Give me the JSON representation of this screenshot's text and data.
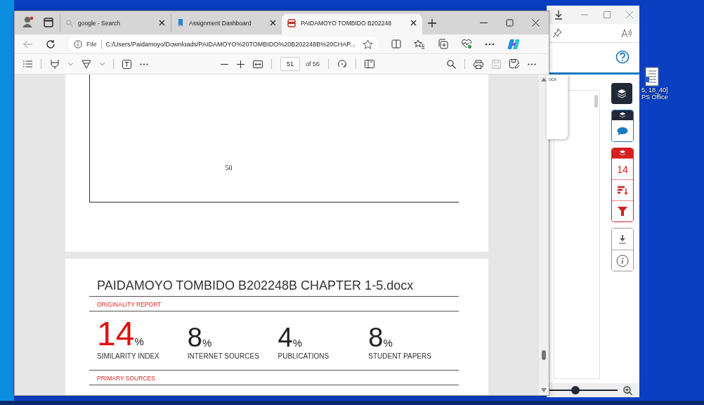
{
  "desktop": {
    "icon_caption": [
      "5, 18_40]",
      "PS Office"
    ]
  },
  "back_window": {
    "popup_text": "ocx",
    "match_count": "14",
    "zoom": {
      "level": 0.39
    }
  },
  "browser": {
    "tabs": [
      {
        "title": "google - Search",
        "kind": "search",
        "selected": false
      },
      {
        "title": "Assignment Dashboard",
        "kind": "app",
        "selected": false
      },
      {
        "title": "PAIDAMOYO TOMBIDO B202248",
        "kind": "pdf",
        "selected": true
      }
    ],
    "address": {
      "scheme": "File",
      "url": "C:/Users/Paidamoyo/Downloads/PAIDAMOYO%20TOMBIDO%20B202248B%20CHAP..."
    },
    "pdf_toolbar": {
      "page": "51",
      "page_count": "of 56"
    }
  },
  "document": {
    "page_number": "50",
    "report": {
      "title": "PAIDAMOYO TOMBIDO B202248B CHAPTER 1-5.docx",
      "section": "ORIGINALITY REPORT",
      "stats": [
        {
          "value": "14",
          "unit": "%",
          "label": "SIMILARITY INDEX",
          "kind": "main"
        },
        {
          "value": "8",
          "unit": "%",
          "label": "INTERNET SOURCES",
          "kind": "sub"
        },
        {
          "value": "4",
          "unit": "%",
          "label": "PUBLICATIONS",
          "kind": "sub"
        },
        {
          "value": "8",
          "unit": "%",
          "label": "STUDENT PAPERS",
          "kind": "sub"
        }
      ],
      "next_section": "PRIMARY SOURCES"
    }
  }
}
